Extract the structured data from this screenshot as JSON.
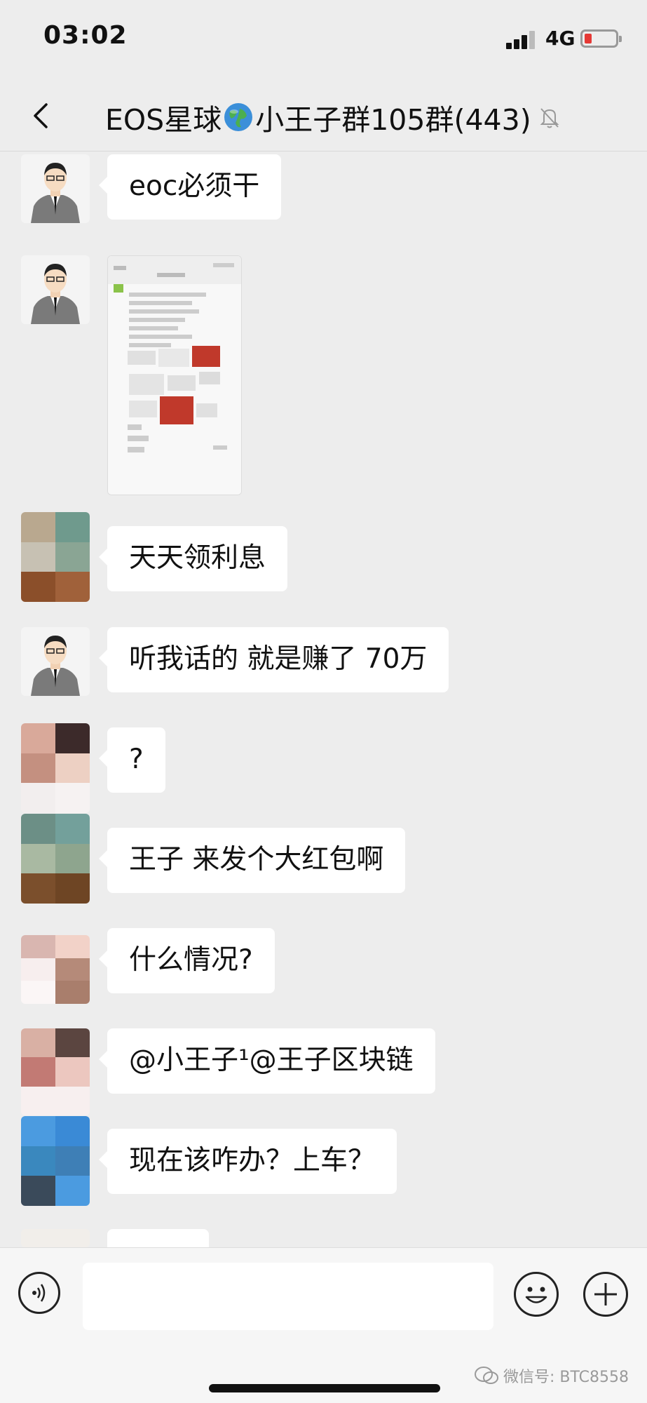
{
  "status_bar": {
    "time": "03:02",
    "network": "4G",
    "signal_icon": "cellular-signal-icon",
    "battery_icon": "battery-low-icon"
  },
  "nav": {
    "title_prefix": "EOS星球",
    "title_suffix": "小王子群105群(443)",
    "back_icon": "chevron-left-icon",
    "globe_icon": "globe-emoji-icon",
    "mute_icon": "bell-muted-icon"
  },
  "messages": [
    {
      "avatar": "cartoon-man-suit",
      "text": "eoc必须干"
    },
    {
      "avatar": "cartoon-man-suit",
      "type": "image"
    },
    {
      "avatar": "pixelated-avatar",
      "text": "天天领利息"
    },
    {
      "avatar": "cartoon-man-suit",
      "text": "听我话的 就是赚了 70万"
    },
    {
      "avatar": "pixelated-avatar",
      "text": "?"
    },
    {
      "avatar": "pixelated-avatar",
      "text": "王子  来发个大红包啊"
    },
    {
      "avatar": "pixelated-avatar",
      "text": "什么情况?"
    },
    {
      "avatar": "pixelated-avatar",
      "text": "@小王子¹@王子区块链"
    },
    {
      "avatar": "pixelated-avatar",
      "text": "现在该咋办？上车？"
    }
  ],
  "input_bar": {
    "voice_icon": "voice-icon",
    "emoji_icon": "emoji-icon",
    "plus_icon": "plus-icon",
    "input_value": ""
  },
  "watermark": {
    "text": "微信号: BTC8558"
  },
  "colors": {
    "background": "#ededed",
    "bubble": "#ffffff",
    "battery_low": "#e53935"
  }
}
